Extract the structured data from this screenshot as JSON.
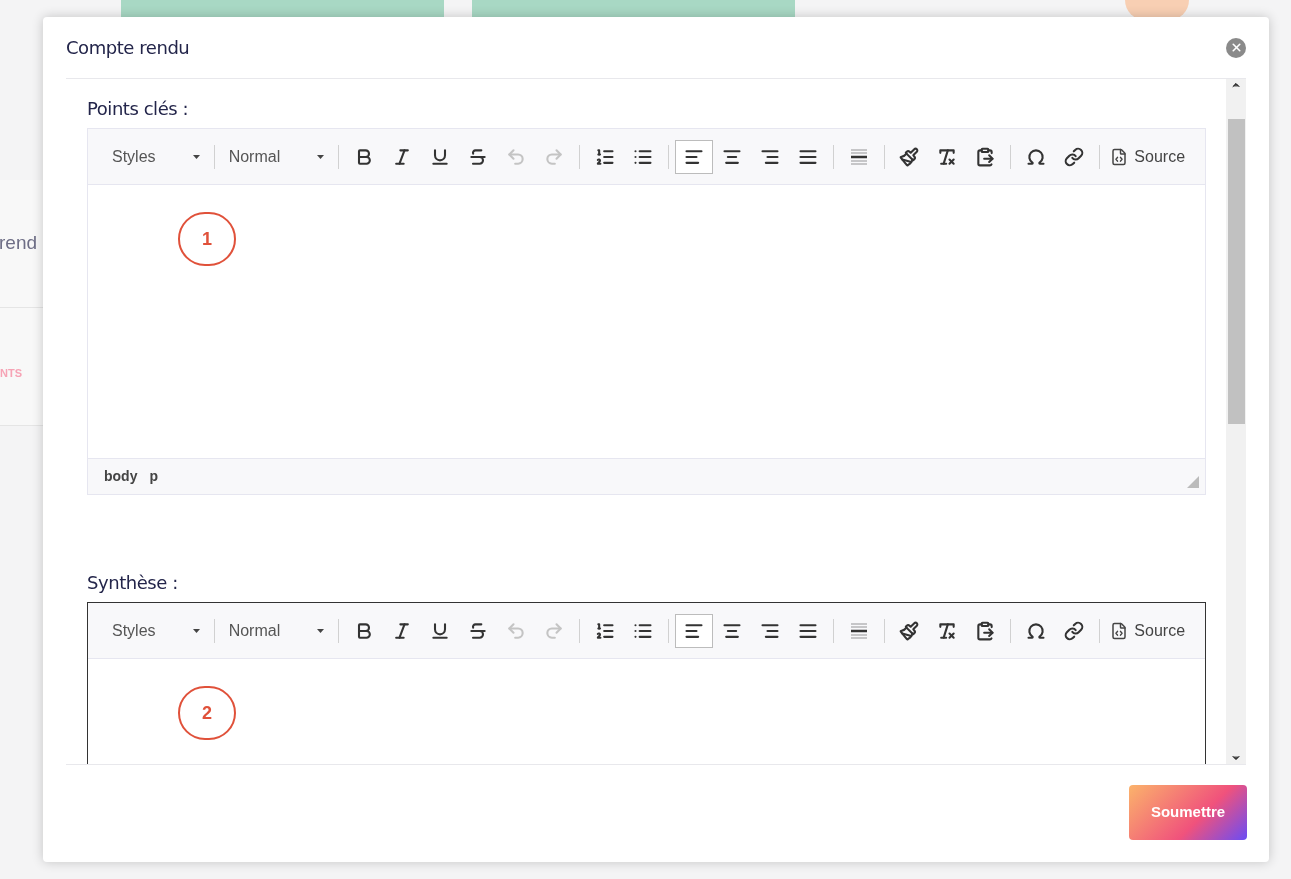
{
  "background": {
    "tab_label": "rend",
    "section_label": "NTS"
  },
  "dialog": {
    "title": "Compte rendu",
    "sections": [
      {
        "label": "Points clés :",
        "focused": false,
        "marker": "1",
        "path": [
          "body",
          "p"
        ],
        "toolbar": {
          "styles": "Styles",
          "format": "Normal",
          "source": "Source",
          "groups": [
            [
              {
                "kind": "bold",
                "disabled": false,
                "selected": false
              },
              {
                "kind": "italic",
                "disabled": false,
                "selected": false
              },
              {
                "kind": "underline",
                "disabled": false,
                "selected": false
              },
              {
                "kind": "strike",
                "disabled": false,
                "selected": false
              },
              {
                "kind": "undo",
                "disabled": true,
                "selected": false
              },
              {
                "kind": "redo",
                "disabled": true,
                "selected": false
              }
            ],
            [
              {
                "kind": "numbered",
                "disabled": false,
                "selected": false
              },
              {
                "kind": "bulleted",
                "disabled": false,
                "selected": false
              }
            ],
            [
              {
                "kind": "left",
                "disabled": false,
                "selected": true
              },
              {
                "kind": "center",
                "disabled": false,
                "selected": false
              },
              {
                "kind": "right",
                "disabled": false,
                "selected": false
              },
              {
                "kind": "justify",
                "disabled": false,
                "selected": false
              }
            ],
            [
              {
                "kind": "rule",
                "disabled": false,
                "selected": false
              }
            ],
            [
              {
                "kind": "brush",
                "disabled": false,
                "selected": false
              },
              {
                "kind": "clear",
                "disabled": false,
                "selected": false
              },
              {
                "kind": "paste",
                "disabled": false,
                "selected": false
              }
            ],
            [
              {
                "kind": "omega",
                "disabled": false,
                "selected": false
              },
              {
                "kind": "link",
                "disabled": false,
                "selected": false
              }
            ]
          ]
        }
      },
      {
        "label": "Synthèse :",
        "focused": true,
        "marker": "2",
        "toolbar": {
          "styles": "Styles",
          "format": "Normal",
          "source": "Source",
          "groups": [
            [
              {
                "kind": "bold",
                "disabled": false,
                "selected": false
              },
              {
                "kind": "italic",
                "disabled": false,
                "selected": false
              },
              {
                "kind": "underline",
                "disabled": false,
                "selected": false
              },
              {
                "kind": "strike",
                "disabled": false,
                "selected": false
              },
              {
                "kind": "undo",
                "disabled": true,
                "selected": false
              },
              {
                "kind": "redo",
                "disabled": true,
                "selected": false
              }
            ],
            [
              {
                "kind": "numbered",
                "disabled": false,
                "selected": false
              },
              {
                "kind": "bulleted",
                "disabled": false,
                "selected": false
              }
            ],
            [
              {
                "kind": "left",
                "disabled": false,
                "selected": true
              },
              {
                "kind": "center",
                "disabled": false,
                "selected": false
              },
              {
                "kind": "right",
                "disabled": false,
                "selected": false
              },
              {
                "kind": "justify",
                "disabled": false,
                "selected": false
              }
            ],
            [
              {
                "kind": "rule",
                "disabled": false,
                "selected": false
              }
            ],
            [
              {
                "kind": "brush",
                "disabled": false,
                "selected": false
              },
              {
                "kind": "clear",
                "disabled": false,
                "selected": false
              },
              {
                "kind": "paste",
                "disabled": false,
                "selected": false
              }
            ],
            [
              {
                "kind": "omega",
                "disabled": false,
                "selected": false
              },
              {
                "kind": "link",
                "disabled": false,
                "selected": false
              }
            ]
          ]
        }
      }
    ],
    "submit": "Soumettre"
  }
}
